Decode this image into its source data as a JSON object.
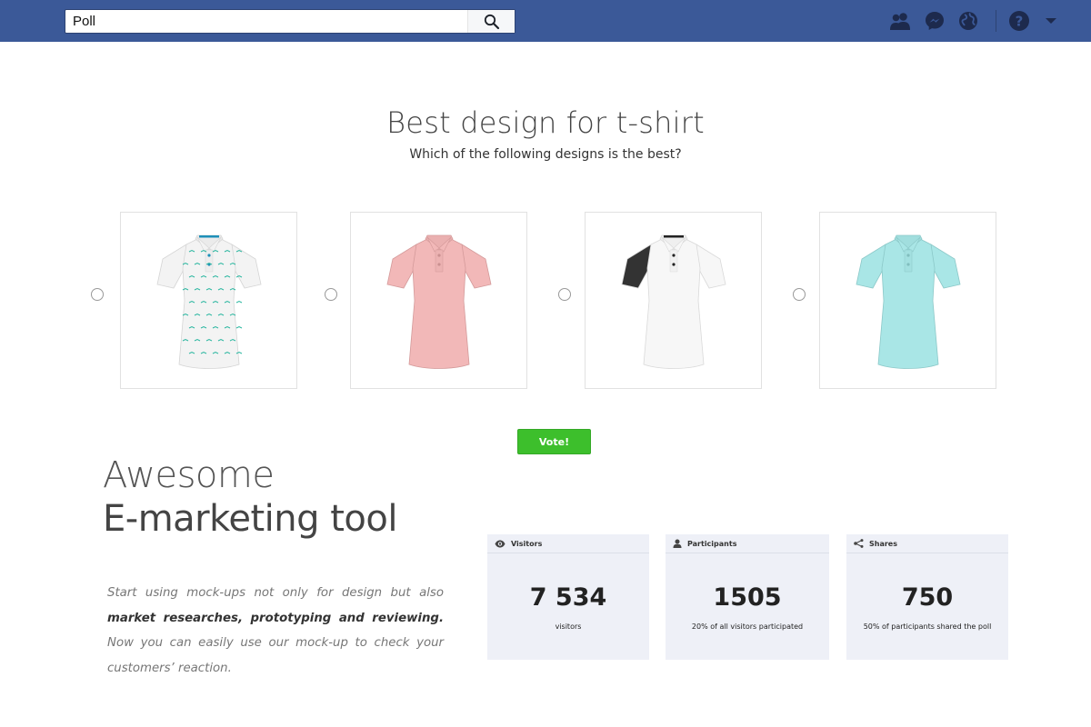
{
  "search": {
    "value": "Poll"
  },
  "poll": {
    "title": "Best design for t-shirt",
    "subtitle": "Which of the following designs is the best?",
    "options": [
      {
        "color": "#f3f3f3",
        "collar": "#1e8fb8",
        "pattern": "#2bb7a0",
        "sleeve": "none"
      },
      {
        "color": "#f2b8b8",
        "collar": "none",
        "pattern": "none",
        "sleeve": "none"
      },
      {
        "color": "#f7f7f7",
        "collar": "#222222",
        "pattern": "none",
        "sleeve": "#333333"
      },
      {
        "color": "#a9e6e6",
        "collar": "none",
        "pattern": "none",
        "sleeve": "none"
      }
    ],
    "vote_label": "Vote!"
  },
  "marketing": {
    "line1": "Awesome",
    "line2": "E-marketing tool",
    "text_a": "Start using mock-ups not only for design but also ",
    "text_b": "market researches, prototyping and reviewing.",
    "text_c": " Now you can easily use our mock-up to check your customers’ reaction."
  },
  "stats": [
    {
      "label": "Visitors",
      "icon": "eye-icon",
      "number": "7 534",
      "caption": "visitors"
    },
    {
      "label": "Participants",
      "icon": "person-icon",
      "number": "1505",
      "caption": "20% of all visitors participated"
    },
    {
      "label": "Shares",
      "icon": "share-icon",
      "number": "750",
      "caption": "50% of participants shared the poll"
    }
  ],
  "colors": {
    "topbar": "#3b5998",
    "vote": "#3dbf2c",
    "stat_bg": "#eef0f7"
  }
}
